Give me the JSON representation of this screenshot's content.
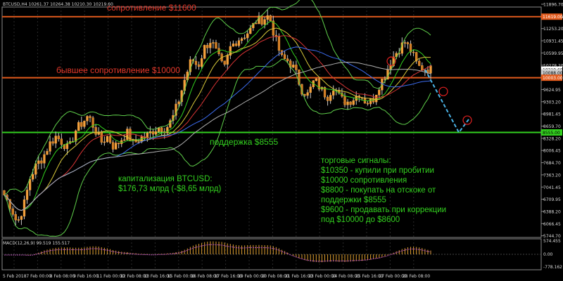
{
  "chart_data": {
    "type": "candlestick",
    "header": "BTCUSD,H4  10261.37 10264.38 10210.30 10219.60",
    "price_scale": [
      "11896.70",
      "11574.95",
      "11253.20",
      "10931.45",
      "10599.95",
      "10278.20",
      "9946.70",
      "9624.95",
      "9303.20",
      "8981.45",
      "8659.70",
      "8328.20",
      "8006.45",
      "7684.70",
      "7363.20",
      "7041.45",
      "6709.95",
      "6388.20",
      "6066.45",
      "5744.70"
    ],
    "price_badges": {
      "resistance": "11619.00",
      "last": "10219.60",
      "mid": "10088.00",
      "higher": "10003.00",
      "support": "8555.00"
    },
    "time_axis": [
      "5 Feb 2018",
      "7 Feb 00:00",
      "8 Feb 08:00",
      "9 Feb 16:00",
      "11 Feb 00:00",
      "12 Feb 08:00",
      "13 Feb 16:00",
      "15 Feb 00:00",
      "16 Feb 08:00",
      "17 Feb 16:00",
      "19 Feb 00:00",
      "20 Feb 08:00",
      "21 Feb 16:00",
      "23 Feb 00:00",
      "24 Feb 08:00",
      "25 Feb 16:00",
      "27 Feb 00:00",
      "28 Feb 08:00"
    ],
    "levels": {
      "resistance": 11619,
      "higher_resistance": 10003,
      "support": 8555
    },
    "ohlc_path": [
      6900,
      6600,
      6150,
      6600,
      7350,
      7700,
      7900,
      8250,
      8450,
      8300,
      8100,
      8600,
      8800,
      9000,
      8650,
      8300,
      8450,
      8150,
      8350,
      8550,
      8250,
      8400,
      8450,
      8600,
      8700,
      8650,
      8900,
      9400,
      10000,
      10500,
      10300,
      10800,
      11000,
      10600,
      10200,
      10800,
      11000,
      11100,
      11250,
      11500,
      11550,
      11650,
      11000,
      10500,
      10450,
      10200,
      9700,
      9550,
      9950,
      9700,
      9500,
      9800,
      9450,
      9350,
      9450,
      9600,
      9350,
      9400,
      9800,
      10100,
      10500,
      10750,
      10950,
      10700,
      10300,
      10250,
      10220
    ],
    "projection": [
      {
        "price": 10220
      },
      {
        "price": 8555
      },
      {
        "price": 8900
      }
    ],
    "macd": {
      "label": "MACD(12,26,9) 99.519 155.517",
      "scale_top": "574.455",
      "scale_zero": "0.00",
      "scale_bottom": "-778.162"
    }
  },
  "annotations": {
    "resistance": "сопротивление $11600",
    "higher_resistance": "бывшее сопротивление $10000",
    "support": "поддержка $8555",
    "capitalization": [
      "капитализация BTCUSD:",
      "$176,73 млрд (-$8,65 млрд)"
    ],
    "signals": [
      "торговые сигналы:",
      "$10350 - купили при пробитии",
      "$10000 сопротивления",
      "$8800 - покупать на отскоке от",
      "поддержки $8555",
      "$9600 - продавать при коррекции",
      "под $10000 до $8600"
    ]
  }
}
